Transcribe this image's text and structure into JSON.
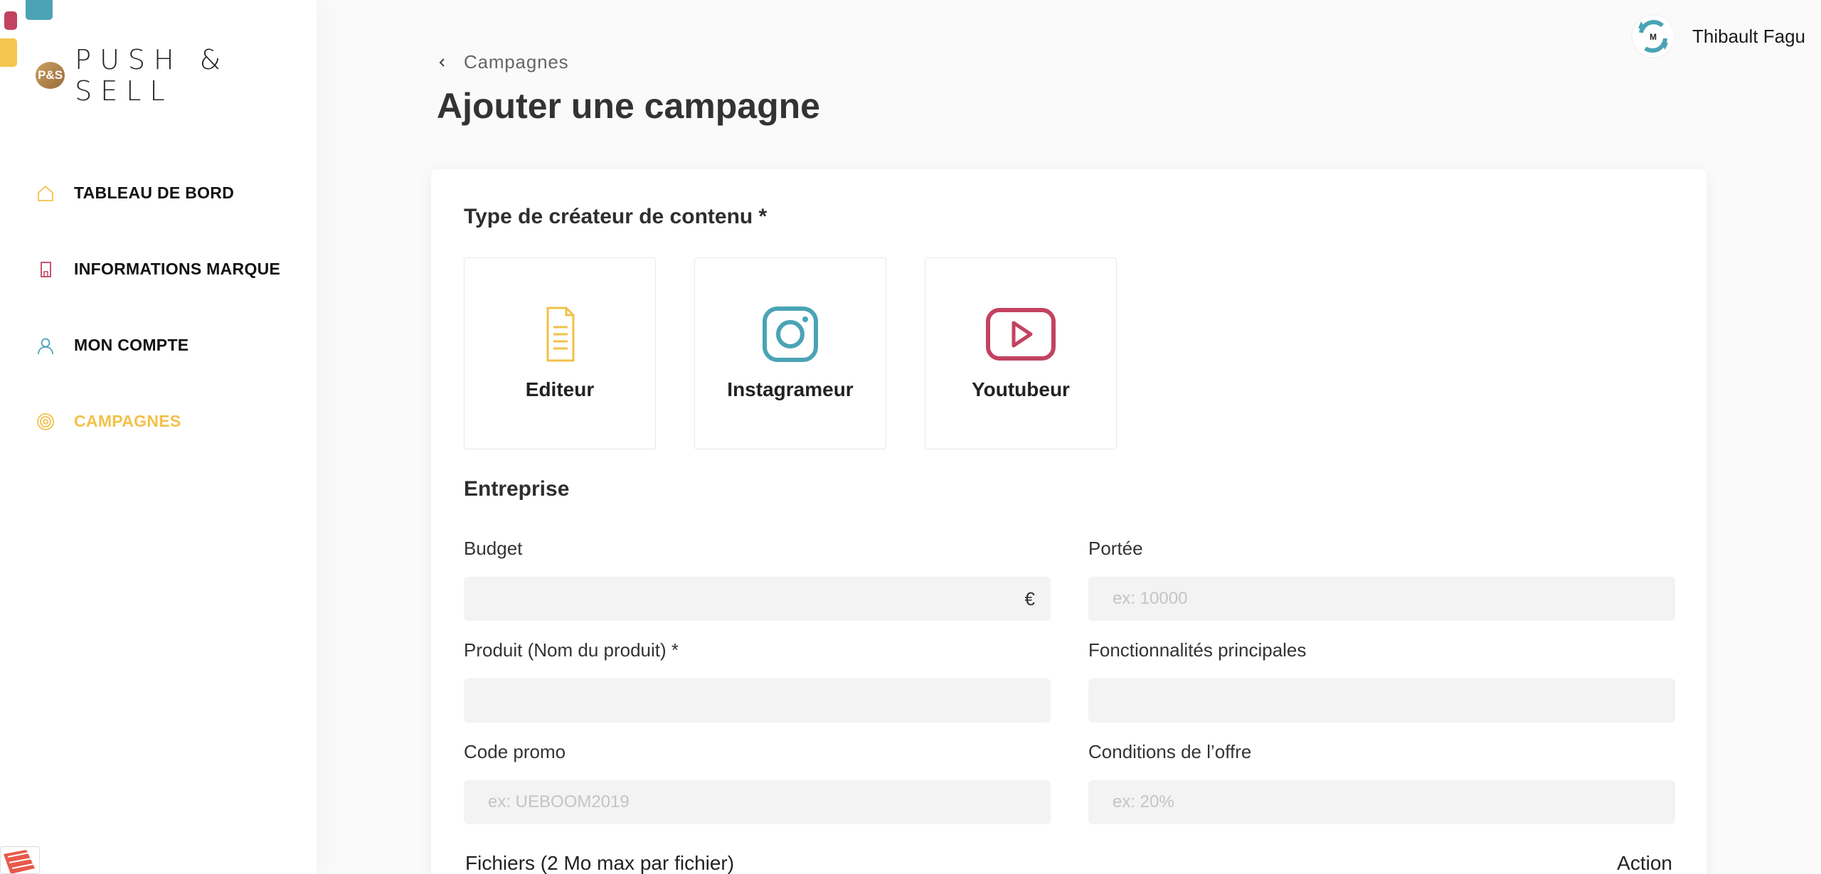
{
  "brand": {
    "logo_badge": "P&S",
    "logo_text": "PUSH & SELL",
    "colors": {
      "yellow": "#f2c14a",
      "red": "#c2435f",
      "teal": "#4aa3b5"
    }
  },
  "sidebar": {
    "items": [
      {
        "label": "TABLEAU DE BORD",
        "icon": "home-icon"
      },
      {
        "label": "INFORMATIONS MARQUE",
        "icon": "building-icon"
      },
      {
        "label": "MON COMPTE",
        "icon": "user-icon"
      },
      {
        "label": "CAMPAGNES",
        "icon": "target-icon",
        "active": true
      }
    ]
  },
  "header": {
    "user_name": "Thibault Fagu",
    "avatar_initials": "M",
    "breadcrumb": "Campagnes",
    "title": "Ajouter une campagne"
  },
  "form": {
    "type_section_title": "Type de créateur de contenu *",
    "types": [
      {
        "label": "Editeur",
        "icon": "document-icon"
      },
      {
        "label": "Instagrameur",
        "icon": "instagram-icon"
      },
      {
        "label": "Youtubeur",
        "icon": "youtube-icon"
      }
    ],
    "entreprise_title": "Entreprise",
    "budget": {
      "label": "Budget",
      "value": "",
      "placeholder": "",
      "suffix": "€"
    },
    "portee": {
      "label": "Portée",
      "value": "",
      "placeholder": "ex: 10000"
    },
    "produit": {
      "label": "Produit (Nom du produit) *",
      "value": "",
      "placeholder": ""
    },
    "fonctionnalites": {
      "label": "Fonctionnalités principales",
      "value": "",
      "placeholder": ""
    },
    "code_promo": {
      "label": "Code promo",
      "value": "",
      "placeholder": "ex: UEBOOM2019"
    },
    "conditions": {
      "label": "Conditions de l’offre",
      "value": "",
      "placeholder": "ex: 20%"
    },
    "files_label": "Fichiers (2 Mo max par fichier)",
    "action_label": "Action"
  }
}
